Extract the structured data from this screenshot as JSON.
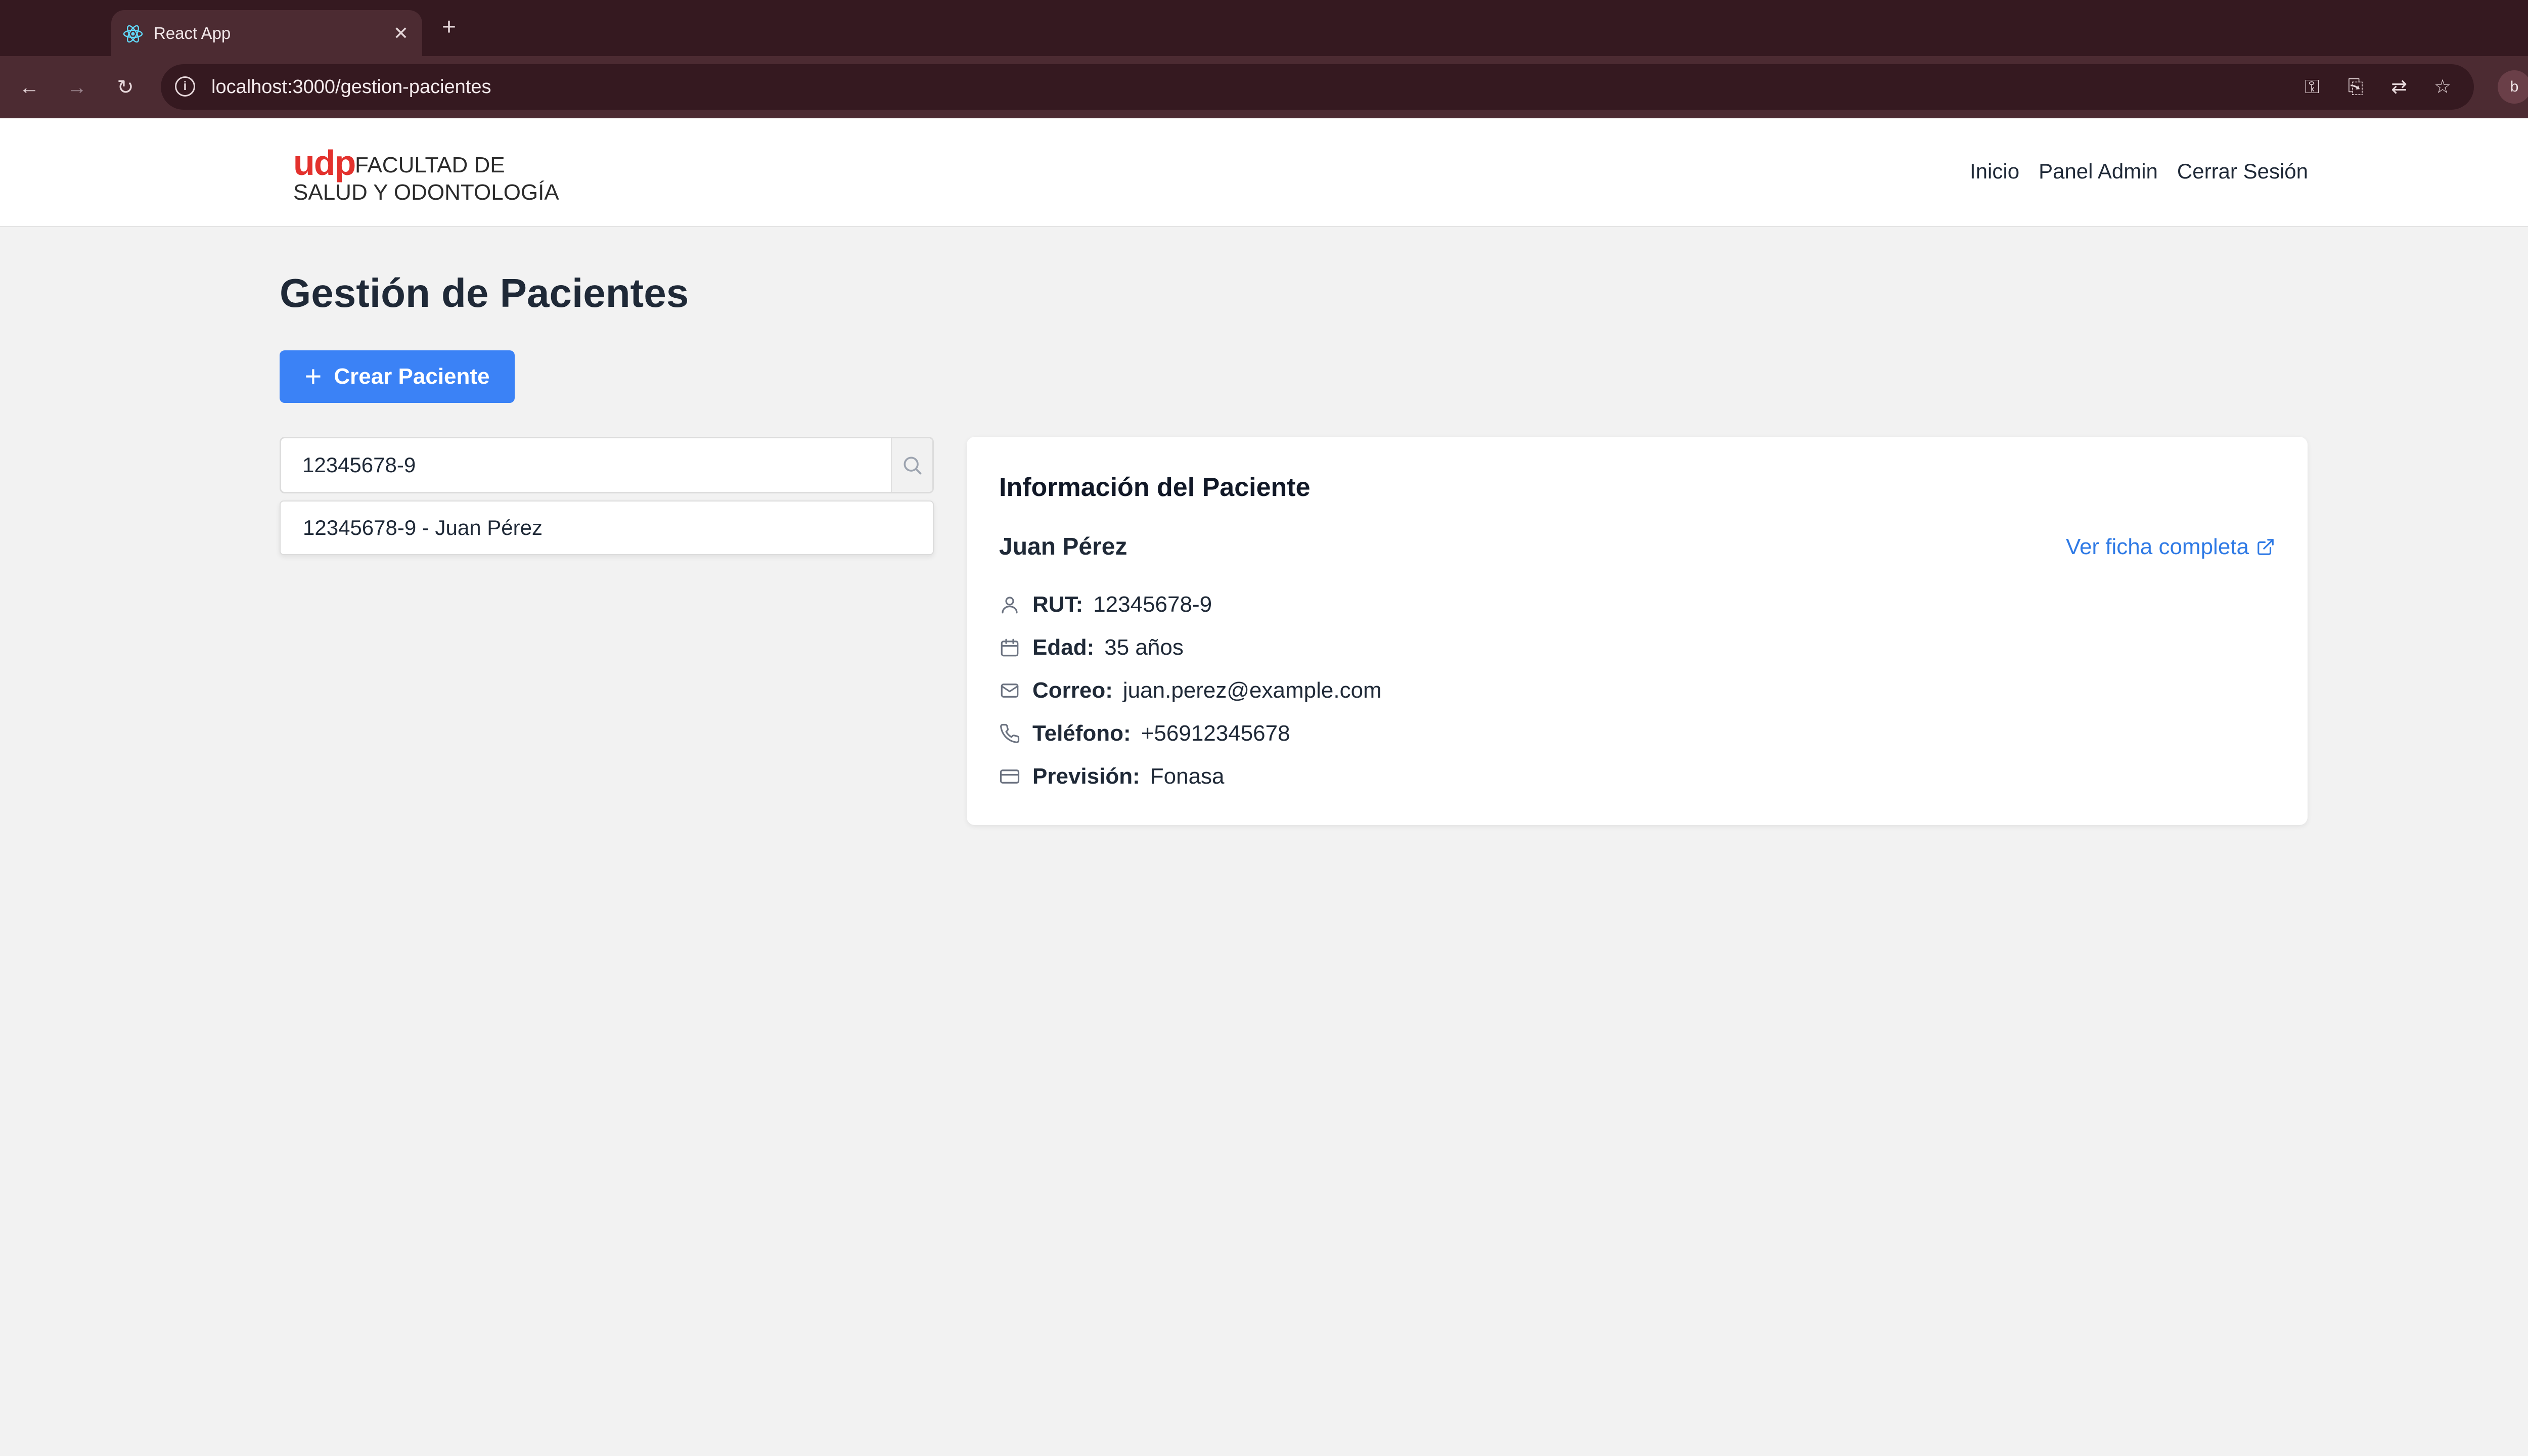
{
  "browser": {
    "tab_title": "React App",
    "new_tab": "+",
    "url": "localhost:3000/gestion-pacientes",
    "profile_initial": "b"
  },
  "header": {
    "logo_udp": "udp",
    "logo_line1": "FACULTAD DE",
    "logo_line2": "SALUD Y ODONTOLOGÍA",
    "nav": [
      "Inicio",
      "Panel Admin",
      "Cerrar Sesión"
    ]
  },
  "page": {
    "title": "Gestión de Pacientes",
    "create_button": "Crear Paciente"
  },
  "search": {
    "value": "12345678-9",
    "suggestion": "12345678-9 - Juan Pérez"
  },
  "patient": {
    "card_title": "Información del Paciente",
    "name": "Juan Pérez",
    "full_record_link": "Ver ficha completa",
    "fields": [
      {
        "icon": "user-icon",
        "label": "RUT:",
        "value": "12345678-9"
      },
      {
        "icon": "calendar-icon",
        "label": "Edad:",
        "value": "35 años"
      },
      {
        "icon": "mail-icon",
        "label": "Correo:",
        "value": "juan.perez@example.com"
      },
      {
        "icon": "phone-icon",
        "label": "Teléfono:",
        "value": "+56912345678"
      },
      {
        "icon": "credit-card-icon",
        "label": "Previsión:",
        "value": "Fonasa"
      }
    ]
  },
  "colors": {
    "primary": "#3b82f6",
    "link": "#2f7ae5",
    "brand_red": "#e3312d",
    "browser_dark": "#351920",
    "browser_toolbar": "#4c2b32",
    "page_bg": "#f2f2f2"
  }
}
